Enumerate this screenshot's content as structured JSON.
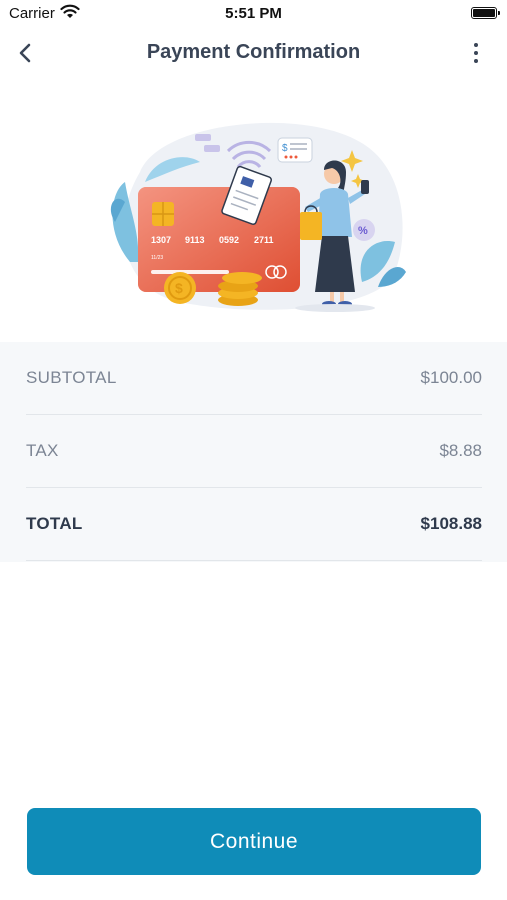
{
  "status_bar": {
    "carrier": "Carrier",
    "time": "5:51 PM"
  },
  "nav": {
    "title": "Payment Confirmation"
  },
  "illustration": {
    "card_number": [
      "1307",
      "9113",
      "0592",
      "2711"
    ],
    "card_expiry": "11/23"
  },
  "summary": {
    "rows": [
      {
        "label": "SUBTOTAL",
        "value": "$100.00"
      },
      {
        "label": "TAX",
        "value": "$8.88"
      },
      {
        "label": "TOTAL",
        "value": "$108.88"
      }
    ]
  },
  "actions": {
    "continue_label": "Continue"
  },
  "colors": {
    "accent": "#0f8cb8",
    "card": "#ee5a3c",
    "coin": "#f4b524"
  }
}
